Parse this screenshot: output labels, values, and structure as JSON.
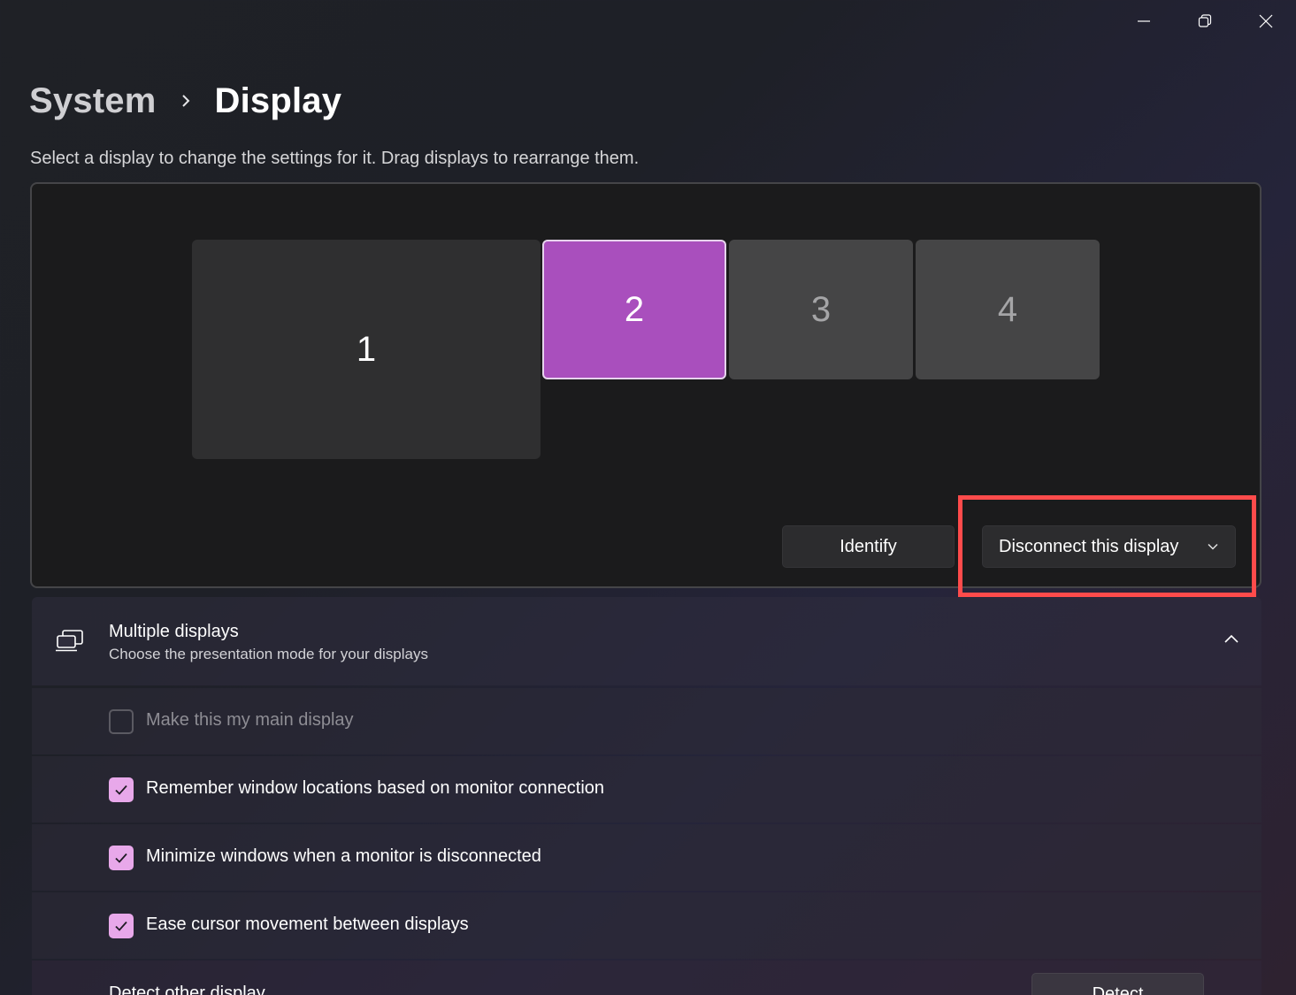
{
  "window_controls": {
    "minimize_icon": "minimize-icon",
    "restore_icon": "restore-icon",
    "close_icon": "close-icon"
  },
  "breadcrumb": {
    "parent": "System",
    "current": "Display"
  },
  "instructions": "Select a display to change the settings for it. Drag displays to rearrange them.",
  "monitors": [
    {
      "label": "1",
      "selected": false
    },
    {
      "label": "2",
      "selected": true
    },
    {
      "label": "3",
      "selected": false
    },
    {
      "label": "4",
      "selected": false
    }
  ],
  "buttons": {
    "identify": "Identify",
    "disconnect": "Disconnect this display"
  },
  "highlight_color": "#ff4b4b",
  "accent_color": "#a94fbd",
  "multiple_displays": {
    "title": "Multiple displays",
    "subtitle": "Choose the presentation mode for your displays",
    "icon": "multiple-displays-icon",
    "expanded": true
  },
  "options": [
    {
      "label": "Make this my main display",
      "checked": false,
      "disabled": true
    },
    {
      "label": "Remember window locations based on monitor connection",
      "checked": true,
      "disabled": false
    },
    {
      "label": "Minimize windows when a monitor is disconnected",
      "checked": true,
      "disabled": false
    },
    {
      "label": "Ease cursor movement between displays",
      "checked": true,
      "disabled": false
    }
  ],
  "detect": {
    "label": "Detect other display",
    "button": "Detect"
  }
}
